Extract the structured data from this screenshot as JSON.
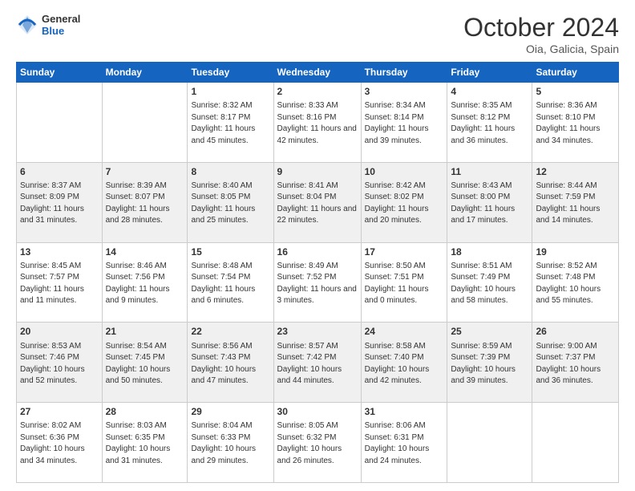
{
  "header": {
    "logo_general": "General",
    "logo_blue": "Blue",
    "month": "October 2024",
    "location": "Oia, Galicia, Spain"
  },
  "days_of_week": [
    "Sunday",
    "Monday",
    "Tuesday",
    "Wednesday",
    "Thursday",
    "Friday",
    "Saturday"
  ],
  "weeks": [
    [
      {
        "day": "",
        "info": ""
      },
      {
        "day": "",
        "info": ""
      },
      {
        "day": "1",
        "info": "Sunrise: 8:32 AM\nSunset: 8:17 PM\nDaylight: 11 hours and 45 minutes."
      },
      {
        "day": "2",
        "info": "Sunrise: 8:33 AM\nSunset: 8:16 PM\nDaylight: 11 hours and 42 minutes."
      },
      {
        "day": "3",
        "info": "Sunrise: 8:34 AM\nSunset: 8:14 PM\nDaylight: 11 hours and 39 minutes."
      },
      {
        "day": "4",
        "info": "Sunrise: 8:35 AM\nSunset: 8:12 PM\nDaylight: 11 hours and 36 minutes."
      },
      {
        "day": "5",
        "info": "Sunrise: 8:36 AM\nSunset: 8:10 PM\nDaylight: 11 hours and 34 minutes."
      }
    ],
    [
      {
        "day": "6",
        "info": "Sunrise: 8:37 AM\nSunset: 8:09 PM\nDaylight: 11 hours and 31 minutes."
      },
      {
        "day": "7",
        "info": "Sunrise: 8:39 AM\nSunset: 8:07 PM\nDaylight: 11 hours and 28 minutes."
      },
      {
        "day": "8",
        "info": "Sunrise: 8:40 AM\nSunset: 8:05 PM\nDaylight: 11 hours and 25 minutes."
      },
      {
        "day": "9",
        "info": "Sunrise: 8:41 AM\nSunset: 8:04 PM\nDaylight: 11 hours and 22 minutes."
      },
      {
        "day": "10",
        "info": "Sunrise: 8:42 AM\nSunset: 8:02 PM\nDaylight: 11 hours and 20 minutes."
      },
      {
        "day": "11",
        "info": "Sunrise: 8:43 AM\nSunset: 8:00 PM\nDaylight: 11 hours and 17 minutes."
      },
      {
        "day": "12",
        "info": "Sunrise: 8:44 AM\nSunset: 7:59 PM\nDaylight: 11 hours and 14 minutes."
      }
    ],
    [
      {
        "day": "13",
        "info": "Sunrise: 8:45 AM\nSunset: 7:57 PM\nDaylight: 11 hours and 11 minutes."
      },
      {
        "day": "14",
        "info": "Sunrise: 8:46 AM\nSunset: 7:56 PM\nDaylight: 11 hours and 9 minutes."
      },
      {
        "day": "15",
        "info": "Sunrise: 8:48 AM\nSunset: 7:54 PM\nDaylight: 11 hours and 6 minutes."
      },
      {
        "day": "16",
        "info": "Sunrise: 8:49 AM\nSunset: 7:52 PM\nDaylight: 11 hours and 3 minutes."
      },
      {
        "day": "17",
        "info": "Sunrise: 8:50 AM\nSunset: 7:51 PM\nDaylight: 11 hours and 0 minutes."
      },
      {
        "day": "18",
        "info": "Sunrise: 8:51 AM\nSunset: 7:49 PM\nDaylight: 10 hours and 58 minutes."
      },
      {
        "day": "19",
        "info": "Sunrise: 8:52 AM\nSunset: 7:48 PM\nDaylight: 10 hours and 55 minutes."
      }
    ],
    [
      {
        "day": "20",
        "info": "Sunrise: 8:53 AM\nSunset: 7:46 PM\nDaylight: 10 hours and 52 minutes."
      },
      {
        "day": "21",
        "info": "Sunrise: 8:54 AM\nSunset: 7:45 PM\nDaylight: 10 hours and 50 minutes."
      },
      {
        "day": "22",
        "info": "Sunrise: 8:56 AM\nSunset: 7:43 PM\nDaylight: 10 hours and 47 minutes."
      },
      {
        "day": "23",
        "info": "Sunrise: 8:57 AM\nSunset: 7:42 PM\nDaylight: 10 hours and 44 minutes."
      },
      {
        "day": "24",
        "info": "Sunrise: 8:58 AM\nSunset: 7:40 PM\nDaylight: 10 hours and 42 minutes."
      },
      {
        "day": "25",
        "info": "Sunrise: 8:59 AM\nSunset: 7:39 PM\nDaylight: 10 hours and 39 minutes."
      },
      {
        "day": "26",
        "info": "Sunrise: 9:00 AM\nSunset: 7:37 PM\nDaylight: 10 hours and 36 minutes."
      }
    ],
    [
      {
        "day": "27",
        "info": "Sunrise: 8:02 AM\nSunset: 6:36 PM\nDaylight: 10 hours and 34 minutes."
      },
      {
        "day": "28",
        "info": "Sunrise: 8:03 AM\nSunset: 6:35 PM\nDaylight: 10 hours and 31 minutes."
      },
      {
        "day": "29",
        "info": "Sunrise: 8:04 AM\nSunset: 6:33 PM\nDaylight: 10 hours and 29 minutes."
      },
      {
        "day": "30",
        "info": "Sunrise: 8:05 AM\nSunset: 6:32 PM\nDaylight: 10 hours and 26 minutes."
      },
      {
        "day": "31",
        "info": "Sunrise: 8:06 AM\nSunset: 6:31 PM\nDaylight: 10 hours and 24 minutes."
      },
      {
        "day": "",
        "info": ""
      },
      {
        "day": "",
        "info": ""
      }
    ]
  ]
}
